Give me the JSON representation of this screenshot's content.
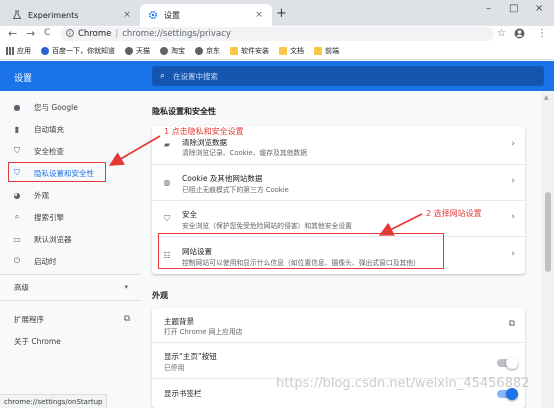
{
  "tabs": [
    {
      "title": "Experiments",
      "close": "×"
    },
    {
      "title": "设置",
      "close": "×"
    }
  ],
  "new_tab": "+",
  "window_controls": {
    "minimize": "–",
    "maximize": "□",
    "close": "×"
  },
  "toolbar": {
    "back": "←",
    "forward": "→",
    "reload": "C",
    "host": "Chrome",
    "separator": "|",
    "path": "chrome://settings/privacy",
    "star": "☆",
    "menu": "⋮"
  },
  "bookmarks": [
    {
      "label": "应用",
      "icon": "apps-grid-icon"
    },
    {
      "label": "百度一下，你就知道",
      "icon": "baidu-paw-icon"
    },
    {
      "label": "天猫",
      "icon": "globe-icon"
    },
    {
      "label": "淘宝",
      "icon": "globe-icon"
    },
    {
      "label": "京东",
      "icon": "globe-icon"
    },
    {
      "label": "软件安装",
      "icon": "folder-icon"
    },
    {
      "label": "文档",
      "icon": "folder-icon"
    },
    {
      "label": "前端",
      "icon": "folder-icon"
    }
  ],
  "settings": {
    "title": "设置",
    "search_placeholder": "在设置中搜索"
  },
  "sidebar": {
    "items": [
      {
        "label": "您与 Google",
        "icon": "person-icon"
      },
      {
        "label": "自动填充",
        "icon": "clipboard-icon"
      },
      {
        "label": "安全检查",
        "icon": "shield-check-icon"
      },
      {
        "label": "隐私设置和安全性",
        "icon": "shield-lock-icon"
      },
      {
        "label": "外观",
        "icon": "palette-icon"
      },
      {
        "label": "搜索引擎",
        "icon": "search-icon"
      },
      {
        "label": "默认浏览器",
        "icon": "browser-icon"
      },
      {
        "label": "启动时",
        "icon": "power-icon"
      }
    ],
    "advanced": "高级",
    "extensions": "扩展程序",
    "about": "关于 Chrome"
  },
  "privacy": {
    "section_title": "隐私设置和安全性",
    "rows": [
      {
        "title": "清除浏览数据",
        "subtitle": "清除浏览记录、Cookie、缓存及其他数据",
        "icon": "trash-icon"
      },
      {
        "title": "Cookie 及其他网站数据",
        "subtitle": "已阻止无痕模式下的第三方 Cookie",
        "icon": "cookie-icon"
      },
      {
        "title": "安全",
        "subtitle": "安全浏览（保护您免受危险网站的侵害）和其他安全设置",
        "icon": "shield-icon"
      },
      {
        "title": "网站设置",
        "subtitle": "控制网站可以使用和显示什么信息（如位置信息、摄像头、弹出式窗口及其他）",
        "icon": "sliders-icon"
      }
    ]
  },
  "appearance": {
    "section_title": "外观",
    "rows": [
      {
        "title": "主题背景",
        "subtitle": "打开 Chrome 网上应用店"
      },
      {
        "title": "显示“主页”按钮",
        "subtitle": "已停用",
        "toggle": false
      },
      {
        "title": "显示书签栏",
        "toggle": true
      }
    ]
  },
  "annotations": {
    "step1": "1 点击隐私和安全设置",
    "step2": "2 选择网站设置",
    "color": "#e53935"
  },
  "status_url": "chrome://settings/onStartup",
  "watermark": "https://blog.csdn.net/weixin_45456882",
  "colors": {
    "accent": "#1a73e8",
    "annotation": "#e53935"
  }
}
